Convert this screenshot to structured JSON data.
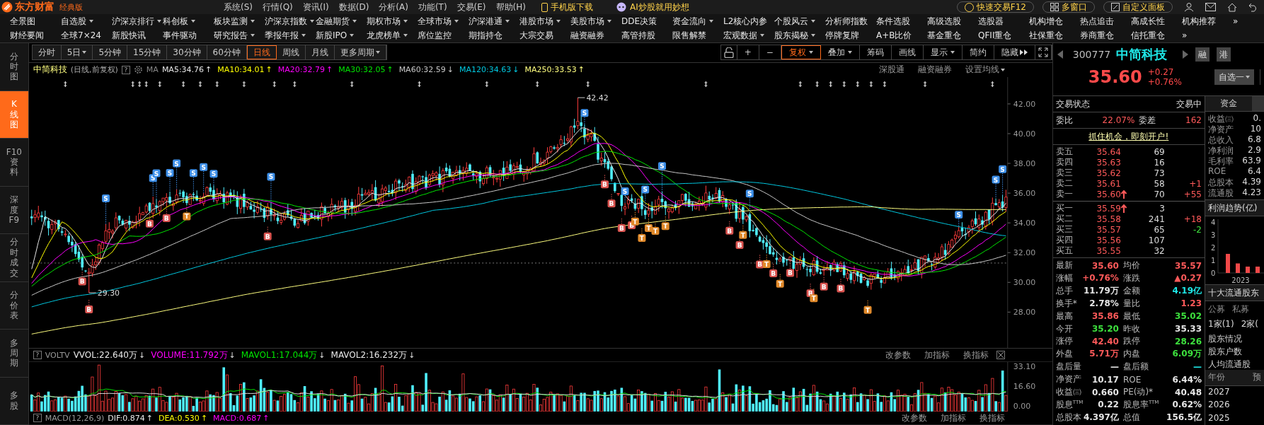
{
  "app": {
    "logo": "东方财富",
    "edition": "经典版",
    "menu": [
      "系统(S)",
      "行情(Q)",
      "资讯(I)",
      "数据(D)",
      "分析(A)",
      "功能(T)",
      "交易(E)",
      "帮助(H)"
    ],
    "promo_buttons": [
      {
        "kind": "phone",
        "label": "手机版下载"
      },
      {
        "kind": "ai",
        "label": "AI炒股就用妙想"
      }
    ],
    "right_buttons": [
      {
        "kind": "trade",
        "label": "快速交易F12"
      },
      {
        "kind": "windows",
        "label": "多窗口"
      },
      {
        "kind": "panel",
        "label": "自定义面板"
      }
    ]
  },
  "nav_rows": [
    [
      {
        "label": "全景图",
        "dropdown": false
      },
      {
        "label": "自选股",
        "dropdown": true
      },
      {
        "label": "沪深京排行",
        "dropdown": true
      },
      {
        "label": "科创板",
        "dropdown": true
      },
      {
        "label": "板块监测",
        "dropdown": true
      },
      {
        "label": "沪深京指数",
        "dropdown": true
      },
      {
        "label": "金融期货",
        "dropdown": true
      },
      {
        "label": "期权市场",
        "dropdown": true
      },
      {
        "label": "全球市场",
        "dropdown": true
      },
      {
        "label": "沪深港通",
        "dropdown": true
      },
      {
        "label": "港股市场",
        "dropdown": true
      },
      {
        "label": "美股市场",
        "dropdown": true
      },
      {
        "label": "DDE决策",
        "dropdown": false
      },
      {
        "label": "资金流向",
        "dropdown": true
      },
      {
        "label": "L2核心内参",
        "dropdown": false
      },
      {
        "label": "个股风云",
        "dropdown": true
      },
      {
        "label": "分析师指数",
        "dropdown": false
      },
      {
        "label": "条件选股",
        "dropdown": false
      },
      {
        "label": "高级选股",
        "dropdown": false
      },
      {
        "label": "选股器",
        "dropdown": false
      },
      {
        "label": "机构增仓",
        "dropdown": false
      },
      {
        "label": "热点追击",
        "dropdown": false
      },
      {
        "label": "高成长性",
        "dropdown": false
      },
      {
        "label": "机构推荐",
        "dropdown": false
      },
      {
        "label": "»",
        "dropdown": false
      }
    ],
    [
      {
        "label": "财经要闻",
        "dropdown": false
      },
      {
        "label": "全球7×24",
        "dropdown": false
      },
      {
        "label": "新股快讯",
        "dropdown": false
      },
      {
        "label": "事件驱动",
        "dropdown": false
      },
      {
        "label": "研究报告",
        "dropdown": true
      },
      {
        "label": "季报年报",
        "dropdown": true
      },
      {
        "label": "新股IPO",
        "dropdown": true
      },
      {
        "label": "龙虎榜单",
        "dropdown": true
      },
      {
        "label": "席位监控",
        "dropdown": false
      },
      {
        "label": "期指持仓",
        "dropdown": false
      },
      {
        "label": "大宗交易",
        "dropdown": false
      },
      {
        "label": "融资融券",
        "dropdown": false
      },
      {
        "label": "高管持股",
        "dropdown": false
      },
      {
        "label": "限售解禁",
        "dropdown": false
      },
      {
        "label": "宏观数据",
        "dropdown": true
      },
      {
        "label": "股东揭秘",
        "dropdown": true
      },
      {
        "label": "停牌复牌",
        "dropdown": false
      },
      {
        "label": "A+B比价",
        "dropdown": false
      },
      {
        "label": "基金重仓",
        "dropdown": false
      },
      {
        "label": "QFII重仓",
        "dropdown": false
      },
      {
        "label": "社保重仓",
        "dropdown": false
      },
      {
        "label": "券商重仓",
        "dropdown": false
      },
      {
        "label": "信托重仓",
        "dropdown": false
      },
      {
        "label": "»",
        "dropdown": false
      }
    ]
  ],
  "side_tabs": [
    {
      "label": "分时图",
      "selected": false
    },
    {
      "label": "K线图",
      "selected": true
    },
    {
      "label": "F10资料",
      "selected": false
    },
    {
      "label": "深度F9",
      "selected": false
    },
    {
      "label": "分时成交",
      "selected": false
    },
    {
      "label": "分价表",
      "selected": false
    },
    {
      "label": "多周期",
      "selected": false
    },
    {
      "label": "多股",
      "selected": false
    }
  ],
  "periods": [
    {
      "label": "分时",
      "dropdown": false,
      "selected": false
    },
    {
      "label": "5日",
      "dropdown": true,
      "selected": false
    },
    {
      "label": "5分钟",
      "dropdown": false,
      "selected": false
    },
    {
      "label": "15分钟",
      "dropdown": false,
      "selected": false
    },
    {
      "label": "30分钟",
      "dropdown": false,
      "selected": false
    },
    {
      "label": "60分钟",
      "dropdown": false,
      "selected": false
    },
    {
      "label": "日线",
      "dropdown": false,
      "selected": true
    },
    {
      "label": "周线",
      "dropdown": false,
      "selected": false
    },
    {
      "label": "月线",
      "dropdown": false,
      "selected": false
    },
    {
      "label": "更多周期",
      "dropdown": true,
      "selected": false
    }
  ],
  "tools": [
    {
      "kind": "lock"
    },
    {
      "kind": "text",
      "label": "+",
      "dropdown": false,
      "selected": false
    },
    {
      "kind": "text",
      "label": "−",
      "dropdown": false,
      "selected": false
    },
    {
      "kind": "text",
      "label": "复权",
      "dropdown": true,
      "selected": true
    },
    {
      "kind": "text",
      "label": "叠加",
      "dropdown": true,
      "selected": false
    },
    {
      "kind": "text",
      "label": "筹码",
      "dropdown": false,
      "selected": false
    },
    {
      "kind": "text",
      "label": "画线",
      "dropdown": false,
      "selected": false
    },
    {
      "kind": "text",
      "label": "显示",
      "dropdown": true,
      "selected": false
    },
    {
      "kind": "text",
      "label": "简约",
      "dropdown": false,
      "selected": false
    },
    {
      "kind": "text",
      "label": "隐藏",
      "dropdown": false,
      "selected": false,
      "play": true
    },
    {
      "kind": "fullscreen"
    }
  ],
  "legend": {
    "name": "中简科技",
    "mode": "(日线,前复权)",
    "help": "?",
    "ma_label": "MA",
    "items": [
      {
        "text": "MA5:34.76",
        "arrow": "↑",
        "color": "#e8e8e8"
      },
      {
        "text": "MA10:34.01",
        "arrow": "↑",
        "color": "#ffff00"
      },
      {
        "text": "MA20:32.79",
        "arrow": "↑",
        "color": "#ff00ff"
      },
      {
        "text": "MA30:32.05",
        "arrow": "↑",
        "color": "#00e600"
      },
      {
        "text": "MA60:32.59",
        "arrow": "↓",
        "color": "#c8c8c8"
      },
      {
        "text": "MA120:34.63",
        "arrow": "↓",
        "color": "#00c8e0"
      },
      {
        "text": "MA250:33.53",
        "arrow": "↑",
        "color": "#ffff80"
      }
    ],
    "links": [
      {
        "label": "深股通",
        "dropdown": false
      },
      {
        "label": "融资融券",
        "dropdown": false
      },
      {
        "label": "设置均线",
        "dropdown": true
      }
    ]
  },
  "price_axis": [
    "42.00",
    "40.00",
    "38.00",
    "36.00",
    "34.00",
    "32.00",
    "30.00",
    "28.00"
  ],
  "extremes": [
    {
      "text": "42.42",
      "kind": "high"
    },
    {
      "text": "29.30",
      "kind": "low"
    }
  ],
  "signals": [
    {
      "label": "B",
      "kind": "buy"
    },
    {
      "label": "B",
      "kind": "buy"
    },
    {
      "label": "S",
      "kind": "sell"
    },
    {
      "label": "B",
      "kind": "buy"
    },
    {
      "label": "S",
      "kind": "sell"
    },
    {
      "label": "S",
      "kind": "sell"
    },
    {
      "label": "B",
      "kind": "buy"
    },
    {
      "label": "S",
      "kind": "sell"
    },
    {
      "label": "S",
      "kind": "sell"
    },
    {
      "label": "T",
      "kind": "t"
    },
    {
      "label": "S",
      "kind": "sell"
    },
    {
      "label": "S",
      "kind": "sell"
    },
    {
      "label": "S",
      "kind": "sell"
    },
    {
      "label": "B",
      "kind": "buy"
    },
    {
      "label": "S",
      "kind": "sell"
    },
    {
      "label": "S",
      "kind": "sell"
    },
    {
      "label": "B",
      "kind": "buy"
    },
    {
      "label": "B",
      "kind": "buy"
    },
    {
      "label": "S",
      "kind": "sell"
    },
    {
      "label": "B",
      "kind": "buy"
    },
    {
      "label": "B",
      "kind": "buy"
    },
    {
      "label": "T",
      "kind": "t"
    },
    {
      "label": "S",
      "kind": "sell"
    },
    {
      "label": "T",
      "kind": "t"
    },
    {
      "label": "T",
      "kind": "t"
    },
    {
      "label": "T",
      "kind": "t"
    },
    {
      "label": "S",
      "kind": "sell"
    },
    {
      "label": "T",
      "kind": "t"
    },
    {
      "label": "B",
      "kind": "buy"
    },
    {
      "label": "B",
      "kind": "buy"
    },
    {
      "label": "T",
      "kind": "t"
    },
    {
      "label": "S",
      "kind": "sell"
    },
    {
      "label": "B",
      "kind": "buy"
    },
    {
      "label": "T",
      "kind": "t"
    },
    {
      "label": "B",
      "kind": "buy"
    },
    {
      "label": "T",
      "kind": "t"
    },
    {
      "label": "B",
      "kind": "buy"
    },
    {
      "label": "B",
      "kind": "buy"
    },
    {
      "label": "T",
      "kind": "t"
    },
    {
      "label": "B",
      "kind": "buy"
    },
    {
      "label": "B",
      "kind": "buy"
    },
    {
      "label": "T",
      "kind": "t"
    },
    {
      "label": "S",
      "kind": "sell"
    },
    {
      "label": "S",
      "kind": "sell"
    },
    {
      "label": "S",
      "kind": "sell"
    }
  ],
  "volume": {
    "help": "?",
    "name": "VOLTV",
    "items": [
      {
        "text": "VVOL:22.640万",
        "arrow": "↓",
        "color": "#e8e8e8"
      },
      {
        "text": "VOLUME:11.792万",
        "arrow": "↓",
        "color": "#ff00ff"
      },
      {
        "text": "MAVOL1:17.044万",
        "arrow": "↓",
        "color": "#00e600"
      },
      {
        "text": "MAVOL2:16.232万",
        "arrow": "↓",
        "color": "#e8e8e8"
      }
    ],
    "actions": [
      "改参数",
      "加指标",
      "换指标"
    ],
    "axis": [
      "33.10",
      "16.60",
      "0.00"
    ]
  },
  "macd": {
    "help": "?",
    "name": "MACD(12,26,9)",
    "items": [
      {
        "text": "DIF:0.874",
        "arrow": "↑",
        "color": "#e8e8e8"
      },
      {
        "text": "DEA:0.530",
        "arrow": "↑",
        "color": "#ffff00"
      },
      {
        "text": "MACD:0.687",
        "arrow": "↑",
        "color": "#ff00ff"
      }
    ],
    "actions": [
      "改参数",
      "加指标",
      "换指标"
    ]
  },
  "quote": {
    "code": "300777",
    "name": "中简科技",
    "price": "35.60",
    "change": "+0.27",
    "change_pct": "+0.76%",
    "tags": [
      "融",
      "港"
    ],
    "watchlist": "自选一",
    "status_label": "交易状态",
    "status": "交易中",
    "side_tab": "资金",
    "ratio": [
      {
        "label": "委比",
        "value": "22.07%"
      },
      {
        "label": "委差",
        "value": "162"
      }
    ],
    "promo": "抓住机会，即刻开户!",
    "asks": [
      {
        "label": "卖五",
        "price": "35.64",
        "volume": "69",
        "up_arrow": false
      },
      {
        "label": "卖四",
        "price": "35.63",
        "volume": "16",
        "up_arrow": false
      },
      {
        "label": "卖三",
        "price": "35.62",
        "volume": "73",
        "up_arrow": false
      },
      {
        "label": "卖二",
        "price": "35.61",
        "volume": "58",
        "change": "+1",
        "color": "#ff5a5a",
        "up_arrow": false
      },
      {
        "label": "卖一",
        "price": "35.60",
        "volume": "70",
        "change": "+55",
        "color": "#ff5a5a",
        "up_arrow": true
      }
    ],
    "bids": [
      {
        "label": "买一",
        "price": "35.59",
        "volume": "3",
        "up_arrow": true
      },
      {
        "label": "买二",
        "price": "35.58",
        "volume": "241",
        "change": "+18",
        "color": "#ff5a5a",
        "up_arrow": false
      },
      {
        "label": "买三",
        "price": "35.57",
        "volume": "65",
        "change": "-2",
        "color": "#3de03d",
        "up_arrow": false
      },
      {
        "label": "买四",
        "price": "35.56",
        "volume": "107",
        "up_arrow": false
      },
      {
        "label": "买五",
        "price": "35.55",
        "volume": "32",
        "up_arrow": false
      }
    ],
    "stats": [
      [
        {
          "label": "最新",
          "value": "35.60",
          "color": "#ff5a5a"
        },
        {
          "label": "均价",
          "value": "35.57",
          "color": "#ff5a5a"
        }
      ],
      [
        {
          "label": "涨幅",
          "value": "+0.76%",
          "color": "#ff5a5a"
        },
        {
          "label": "涨跌",
          "value": "▲0.27",
          "color": "#ff5a5a"
        }
      ],
      [
        {
          "label": "总手",
          "value": "11.79万",
          "color": "#e6e6e6"
        },
        {
          "label": "金额",
          "value": "4.19亿",
          "color": "#1ee6e6"
        }
      ],
      [
        {
          "label": "换手*",
          "value": "2.78%",
          "color": "#e6e6e6"
        },
        {
          "label": "量比",
          "value": "1.23",
          "color": "#ff5a5a"
        }
      ],
      [
        {
          "label": "最高",
          "value": "35.86",
          "color": "#ff5a5a"
        },
        {
          "label": "最低",
          "value": "35.02",
          "color": "#3de03d"
        }
      ],
      [
        {
          "label": "今开",
          "value": "35.20",
          "color": "#3de03d"
        },
        {
          "label": "昨收",
          "value": "35.33",
          "color": "#e6e6e6"
        }
      ],
      [
        {
          "label": "涨停",
          "value": "42.40",
          "color": "#ff5a5a"
        },
        {
          "label": "跌停",
          "value": "28.26",
          "color": "#3de03d"
        }
      ],
      [
        {
          "label": "外盘",
          "value": "5.71万",
          "color": "#ff5a5a"
        },
        {
          "label": "内盘",
          "value": "6.09万",
          "color": "#3de03d"
        }
      ],
      [
        {
          "label": "盘后量",
          "value": "—",
          "color": "#e6e6e6"
        },
        {
          "label": "盘后额",
          "value": "—",
          "color": "#1ee6e6"
        }
      ],
      [
        {
          "label": "净资产",
          "value": "10.17",
          "color": "#e6e6e6"
        },
        {
          "label": "ROE",
          "value": "6.44%",
          "color": "#e6e6e6"
        }
      ],
      [
        {
          "label": "收益㈢",
          "value": "0.660",
          "color": "#e6e6e6"
        },
        {
          "label": "PE(动)*",
          "value": "40.48",
          "color": "#e6e6e6"
        }
      ],
      [
        {
          "label": "股息$^{TTM}$",
          "value": "0.22",
          "color": "#e6e6e6"
        },
        {
          "label": "股息率$^{TTM}$",
          "value": "0.62%",
          "color": "#e6e6e6"
        }
      ],
      [
        {
          "label": "总股本",
          "value": "4.397亿",
          "color": "#e6e6e6"
        },
        {
          "label": "总值",
          "value": "156.5亿",
          "color": "#e6e6e6"
        }
      ]
    ]
  },
  "fundamentals": {
    "rows": [
      {
        "label": "收益㈢",
        "value": "0."
      },
      {
        "label": "净资产",
        "value": "10"
      },
      {
        "label": "总收入",
        "value": "6.8"
      },
      {
        "label": "净利润",
        "value": "2.9"
      },
      {
        "label": "毛利率",
        "value": "63.9"
      },
      {
        "label": "ROE",
        "value": "6.4"
      },
      {
        "label": "总股本",
        "value": "4.39"
      },
      {
        "label": "流通股",
        "value": "4.23"
      }
    ],
    "profit_title": "利润趋势(亿)",
    "chart_data": {
      "type": "bar",
      "xlabel": "2023",
      "categories": [
        null,
        null,
        null,
        null
      ],
      "values": [
        1.5,
        0.75,
        0.5,
        0.5
      ],
      "yticks": [
        0,
        1,
        2,
        3,
        4
      ],
      "ylim": [
        0,
        4
      ]
    },
    "holders_title": "十大流通股东",
    "holder_tabs": [
      "公募",
      "私募"
    ],
    "holder_counts": [
      "1家(1)",
      "2家("
    ],
    "links": [
      "股东情况",
      "股东户数",
      "人均流通股"
    ],
    "year_header": [
      "年份",
      "预"
    ],
    "years": [
      "2027",
      "2026",
      "2025"
    ]
  }
}
